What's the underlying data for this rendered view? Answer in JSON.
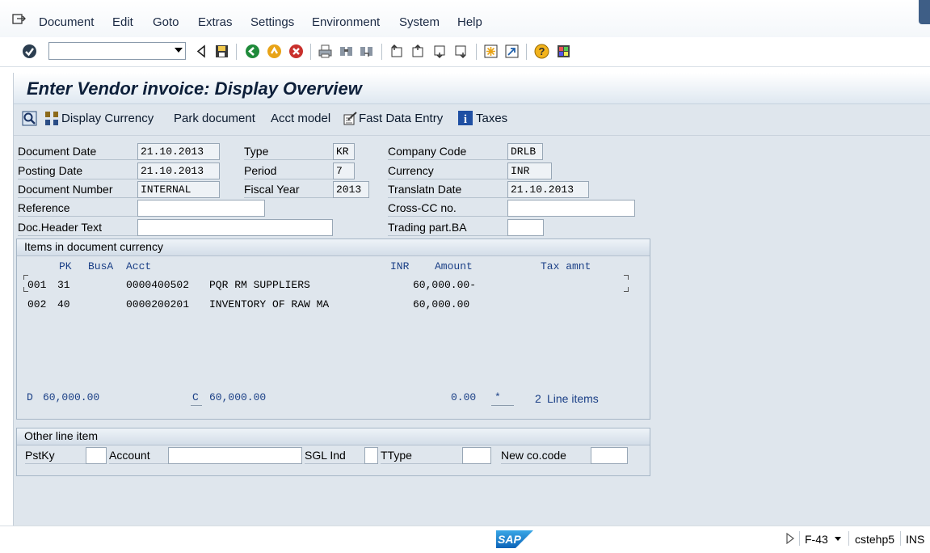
{
  "menubar": {
    "items": [
      "Document",
      "Edit",
      "Goto",
      "Extras",
      "Settings",
      "Environment",
      "System",
      "Help"
    ]
  },
  "toolbar": {
    "command_field_value": "",
    "icons": [
      "enter-icon",
      "back-icon",
      "save-icon",
      "navigate-back-icon",
      "exit-icon",
      "cancel-icon",
      "print-icon",
      "find-icon",
      "find-next-icon",
      "first-page-icon",
      "previous-page-icon",
      "next-page-icon",
      "last-page-icon",
      "new-session-icon",
      "shortcut-icon",
      "help-icon",
      "customize-layout-icon"
    ]
  },
  "page": {
    "title": "Enter Vendor invoice: Display Overview"
  },
  "app_toolbar": {
    "display_currency": "Display Currency",
    "park_document": "Park document",
    "acct_model": "Acct model",
    "fast_data_entry": "Fast Data Entry",
    "taxes": "Taxes"
  },
  "header": {
    "document_date": {
      "label": "Document Date",
      "value": "21.10.2013"
    },
    "posting_date": {
      "label": "Posting Date",
      "value": "21.10.2013"
    },
    "document_number": {
      "label": "Document Number",
      "value": "INTERNAL"
    },
    "reference": {
      "label": "Reference",
      "value": ""
    },
    "doc_header_text": {
      "label": "Doc.Header Text",
      "value": ""
    },
    "type": {
      "label": "Type",
      "value": "KR"
    },
    "period": {
      "label": "Period",
      "value": "7"
    },
    "fiscal_year": {
      "label": "Fiscal Year",
      "value": "2013"
    },
    "company_code": {
      "label": "Company Code",
      "value": "DRLB"
    },
    "currency": {
      "label": "Currency",
      "value": "INR"
    },
    "translatn_date": {
      "label": "Translatn Date",
      "value": "21.10.2013"
    },
    "cross_cc_no": {
      "label": "Cross-CC no.",
      "value": ""
    },
    "trading_part_ba": {
      "label": "Trading part.BA",
      "value": ""
    }
  },
  "items": {
    "title": "Items in document currency",
    "columns": {
      "pk": "PK",
      "busa": "BusA",
      "acct": "Acct",
      "currency": "INR",
      "amount": "Amount",
      "tax": "Tax amnt"
    },
    "rows": [
      {
        "no": "001",
        "pk": "31",
        "busa": "",
        "acct": "0000400502",
        "name": "PQR RM SUPPLIERS",
        "amount": "60,000.00-",
        "tax": ""
      },
      {
        "no": "002",
        "pk": "40",
        "busa": "",
        "acct": "0000200201",
        "name": "INVENTORY OF RAW MA",
        "amount": "60,000.00",
        "tax": ""
      }
    ],
    "totals": {
      "debit_label": "D",
      "debit": "60,000.00",
      "credit_label": "C",
      "credit": "60,000.00",
      "balance": "0.00",
      "status": "*",
      "line_count": "2",
      "line_items_label": "Line items"
    }
  },
  "other_line_item": {
    "title": "Other line item",
    "pstky": {
      "label": "PstKy",
      "value": ""
    },
    "account": {
      "label": "Account",
      "value": ""
    },
    "sgl_ind": {
      "label": "SGL Ind",
      "value": ""
    },
    "ttype": {
      "label": "TType",
      "value": ""
    },
    "new_co_code": {
      "label": "New co.code",
      "value": ""
    }
  },
  "statusbar": {
    "logo": "SAP",
    "transaction": "F-43",
    "server": "cstehp5",
    "mode": "INS"
  },
  "colors": {
    "background": "#dfe6ed",
    "accent_blue": "#1a3f86",
    "title": "#0d1f3a"
  }
}
